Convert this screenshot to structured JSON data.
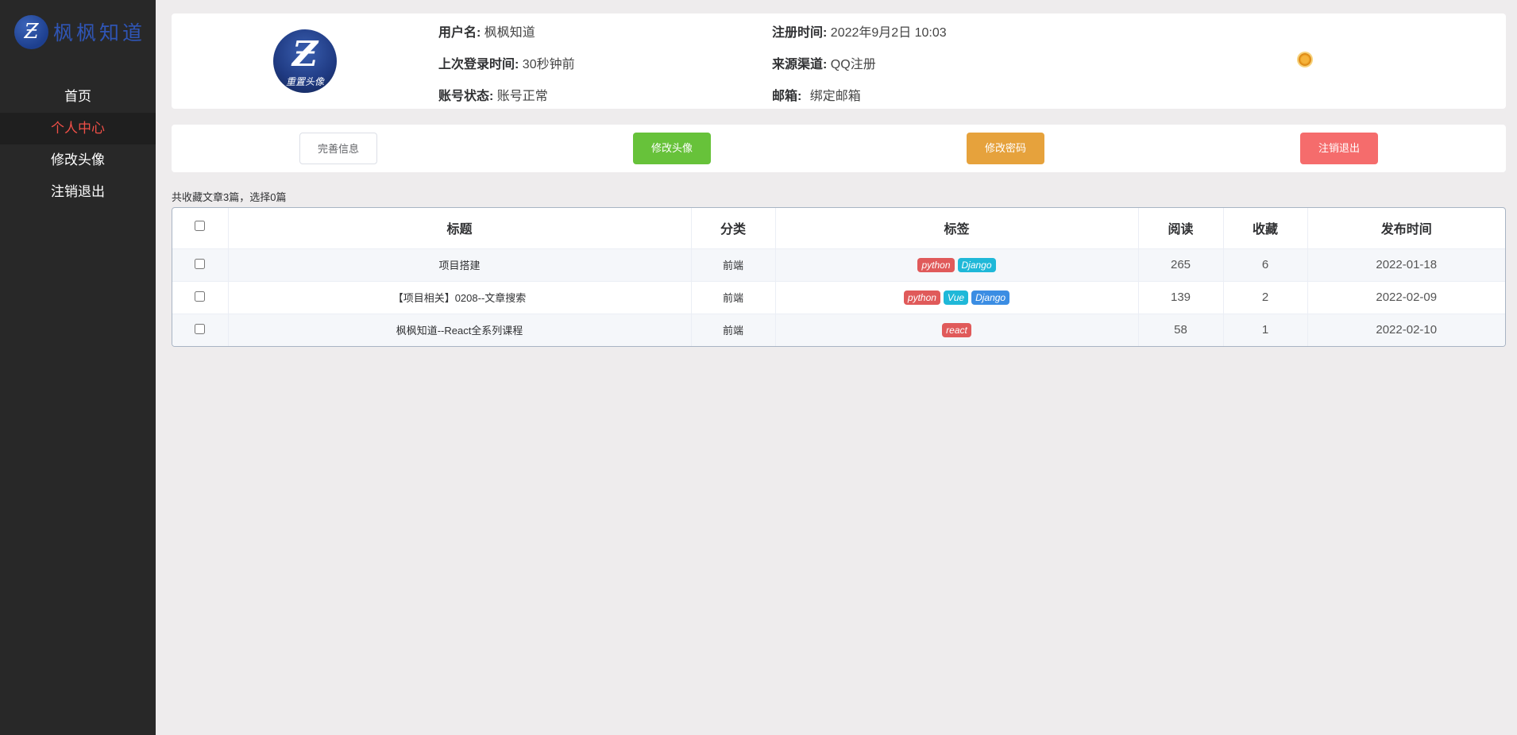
{
  "logo": {
    "text": "枫枫知道"
  },
  "nav": [
    {
      "label": "首页",
      "active": false
    },
    {
      "label": "个人中心",
      "active": true
    },
    {
      "label": "修改头像",
      "active": false
    },
    {
      "label": "注销退出",
      "active": false
    }
  ],
  "profile": {
    "avatar_caption": "重置头像",
    "username_label": "用户名:",
    "username": "枫枫知道",
    "last_login_label": "上次登录时间:",
    "last_login": "30秒钟前",
    "status_label": "账号状态:",
    "status": "账号正常",
    "register_label": "注册时间:",
    "register_time": "2022年9月2日 10:03",
    "source_label": "来源渠道:",
    "source": "QQ注册",
    "email_label": "邮箱:",
    "email": "绑定邮箱"
  },
  "actions": {
    "complete_info": "完善信息",
    "change_avatar": "修改头像",
    "change_password": "修改密码",
    "logout": "注销退出"
  },
  "summary": "共收藏文章3篇，选择0篇",
  "table": {
    "headers": [
      "标题",
      "分类",
      "标签",
      "阅读",
      "收藏",
      "发布时间"
    ],
    "rows": [
      {
        "title": "项目搭建",
        "category": "前端",
        "tags": [
          {
            "name": "python",
            "color": "#e05a5a"
          },
          {
            "name": "Django",
            "color": "#1fb8d8"
          }
        ],
        "reads": "265",
        "favs": "6",
        "date": "2022-01-18"
      },
      {
        "title": "【项目相关】0208--文章搜索",
        "category": "前端",
        "tags": [
          {
            "name": "python",
            "color": "#e05a5a"
          },
          {
            "name": "Vue",
            "color": "#1fb8d8"
          },
          {
            "name": "Django",
            "color": "#3b8de3"
          }
        ],
        "reads": "139",
        "favs": "2",
        "date": "2022-02-09"
      },
      {
        "title": "枫枫知道--React全系列课程",
        "category": "前端",
        "tags": [
          {
            "name": "react",
            "color": "#e05a5a"
          }
        ],
        "reads": "58",
        "favs": "1",
        "date": "2022-02-10"
      }
    ]
  }
}
